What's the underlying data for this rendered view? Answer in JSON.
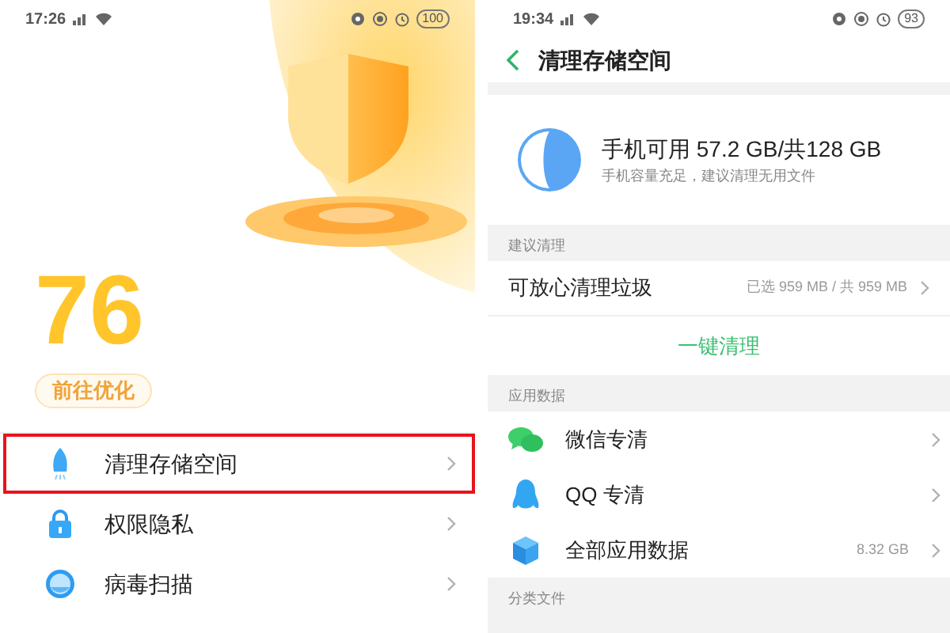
{
  "left_screen": {
    "status_bar": {
      "time": "17:26",
      "battery": "100"
    },
    "score": "76",
    "optimize_button": "前往优化",
    "menu": [
      {
        "label": "清理存储空间",
        "highlighted": true
      },
      {
        "label": "权限隐私",
        "highlighted": false
      },
      {
        "label": "病毒扫描",
        "highlighted": false
      }
    ]
  },
  "right_screen": {
    "status_bar": {
      "time": "19:34",
      "battery": "93"
    },
    "title": "清理存储空间",
    "storage": {
      "headline": "手机可用 57.2 GB/共128 GB",
      "note": "手机容量充足，建议清理无用文件"
    },
    "sections": [
      {
        "label": "建议清理",
        "rows": [
          {
            "kind": "plain",
            "label": "可放心清理垃圾",
            "value": "已选 959 MB / 共 959 MB"
          },
          {
            "kind": "action",
            "label": "一键清理"
          }
        ]
      },
      {
        "label": "应用数据",
        "rows": [
          {
            "kind": "app",
            "label": "微信专清"
          },
          {
            "kind": "app",
            "label": "QQ 专清"
          },
          {
            "kind": "app",
            "label": "全部应用数据",
            "value": "8.32 GB"
          }
        ]
      },
      {
        "label": "分类文件"
      }
    ]
  }
}
